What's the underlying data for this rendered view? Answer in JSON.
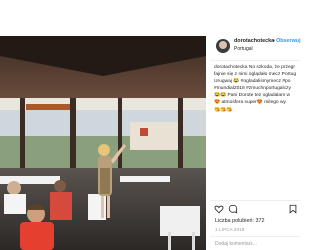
{
  "post": {
    "author": {
      "username": "dorotachotecka",
      "separator": "•",
      "follow_label": "Obserwuj",
      "location": "Portugal"
    },
    "caption": {
      "lines": [
        "dorotachotecka No szkoda, że przegr",
        "fajnie się z nimi oglądało mecz Portug",
        "Urugwaj 😂 #ogladalismymecz #po",
        "#mundial2018 #zmuchnportugalczy",
        "😂😂 Pani Dorote tez ogladalam w",
        "😍 atmosfera super😍 milego wy",
        "😘😘😘"
      ]
    },
    "actions": {
      "like_icon": "heart-icon",
      "comment_icon": "comment-icon",
      "save_icon": "bookmark-icon"
    },
    "likes_text": "Liczba polubień: 372",
    "date_text": "1 LIPCA 2018",
    "comment_placeholder": "Dodaj komentarz..."
  },
  "colors": {
    "link": "#3897f0",
    "text": "#262626",
    "muted": "#999999"
  }
}
